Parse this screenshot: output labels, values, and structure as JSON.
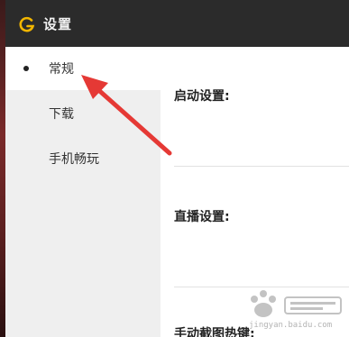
{
  "window": {
    "title": "设置"
  },
  "sidebar": {
    "items": [
      {
        "label": "常规",
        "active": true
      },
      {
        "label": "下载",
        "active": false
      },
      {
        "label": "手机畅玩",
        "active": false
      }
    ]
  },
  "content": {
    "sections": [
      {
        "title": "启动设置:"
      },
      {
        "title": "直播设置:"
      },
      {
        "title": "手动截图热键:"
      }
    ]
  },
  "annotation": {
    "arrow_color": "#e53935"
  },
  "watermark": {
    "site": "jingyan.baidu.com"
  },
  "colors": {
    "titlebar": "#2b2b2b",
    "logo": "#f2b600",
    "sidebar": "#efefef"
  }
}
